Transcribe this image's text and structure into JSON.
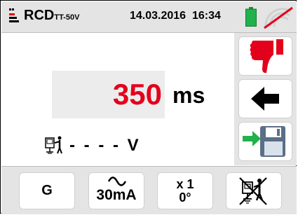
{
  "header": {
    "mode": "RCD",
    "mode_sub": "TT-50V",
    "date": "14.03.2016",
    "time": "16:34",
    "battery_color": "#22b14c",
    "signal_disabled_color": "#e3001b"
  },
  "measurement": {
    "trip_time_value": "350",
    "trip_time_unit": "ms",
    "touch_voltage_value": "- - - -",
    "touch_voltage_unit": "V",
    "value_color": "#e3001b"
  },
  "side_buttons": {
    "result_icon": "thumbs-down-icon",
    "back_icon": "back-arrow-icon",
    "save_icon": "save-icon"
  },
  "bottom_buttons": {
    "rcd_type_label": "G",
    "current_label": "30mA",
    "current_waveform_icon": "sine-wave-icon",
    "multiplier_label": "x 1",
    "phase_label": "0°",
    "earth_icon": "earth-disabled-icon"
  }
}
